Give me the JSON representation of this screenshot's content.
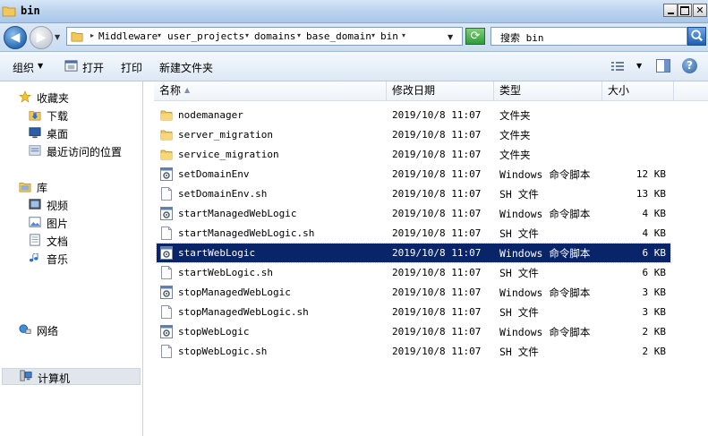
{
  "window": {
    "title": "bin"
  },
  "address": {
    "crumbs": [
      "Middleware",
      "user_projects",
      "domains",
      "base_domain",
      "bin"
    ],
    "search_placeholder": "搜索 bin"
  },
  "toolbar": {
    "organize": "组织",
    "open": "打开",
    "print": "打印",
    "new_folder": "新建文件夹"
  },
  "sidebar": {
    "favorites": "收藏夹",
    "download": "下载",
    "desktop": "桌面",
    "recent": "最近访问的位置",
    "libraries": "库",
    "videos": "视频",
    "pictures": "图片",
    "documents": "文档",
    "music": "音乐",
    "computer": "计算机",
    "network": "网络"
  },
  "columns": {
    "name": "名称",
    "date": "修改日期",
    "type": "类型",
    "size": "大小"
  },
  "files": [
    {
      "name": "nodemanager",
      "date": "2019/10/8 11:07",
      "type": "文件夹",
      "size": "",
      "kind": "folder"
    },
    {
      "name": "server_migration",
      "date": "2019/10/8 11:07",
      "type": "文件夹",
      "size": "",
      "kind": "folder"
    },
    {
      "name": "service_migration",
      "date": "2019/10/8 11:07",
      "type": "文件夹",
      "size": "",
      "kind": "folder"
    },
    {
      "name": "setDomainEnv",
      "date": "2019/10/8 11:07",
      "type": "Windows 命令脚本",
      "size": "12 KB",
      "kind": "cmd"
    },
    {
      "name": "setDomainEnv.sh",
      "date": "2019/10/8 11:07",
      "type": "SH 文件",
      "size": "13 KB",
      "kind": "sh"
    },
    {
      "name": "startManagedWebLogic",
      "date": "2019/10/8 11:07",
      "type": "Windows 命令脚本",
      "size": "4 KB",
      "kind": "cmd"
    },
    {
      "name": "startManagedWebLogic.sh",
      "date": "2019/10/8 11:07",
      "type": "SH 文件",
      "size": "4 KB",
      "kind": "sh"
    },
    {
      "name": "startWebLogic",
      "date": "2019/10/8 11:07",
      "type": "Windows 命令脚本",
      "size": "6 KB",
      "kind": "cmd",
      "selected": true
    },
    {
      "name": "startWebLogic.sh",
      "date": "2019/10/8 11:07",
      "type": "SH 文件",
      "size": "6 KB",
      "kind": "sh"
    },
    {
      "name": "stopManagedWebLogic",
      "date": "2019/10/8 11:07",
      "type": "Windows 命令脚本",
      "size": "3 KB",
      "kind": "cmd"
    },
    {
      "name": "stopManagedWebLogic.sh",
      "date": "2019/10/8 11:07",
      "type": "SH 文件",
      "size": "3 KB",
      "kind": "sh"
    },
    {
      "name": "stopWebLogic",
      "date": "2019/10/8 11:07",
      "type": "Windows 命令脚本",
      "size": "2 KB",
      "kind": "cmd"
    },
    {
      "name": "stopWebLogic.sh",
      "date": "2019/10/8 11:07",
      "type": "SH 文件",
      "size": "2 KB",
      "kind": "sh"
    }
  ]
}
